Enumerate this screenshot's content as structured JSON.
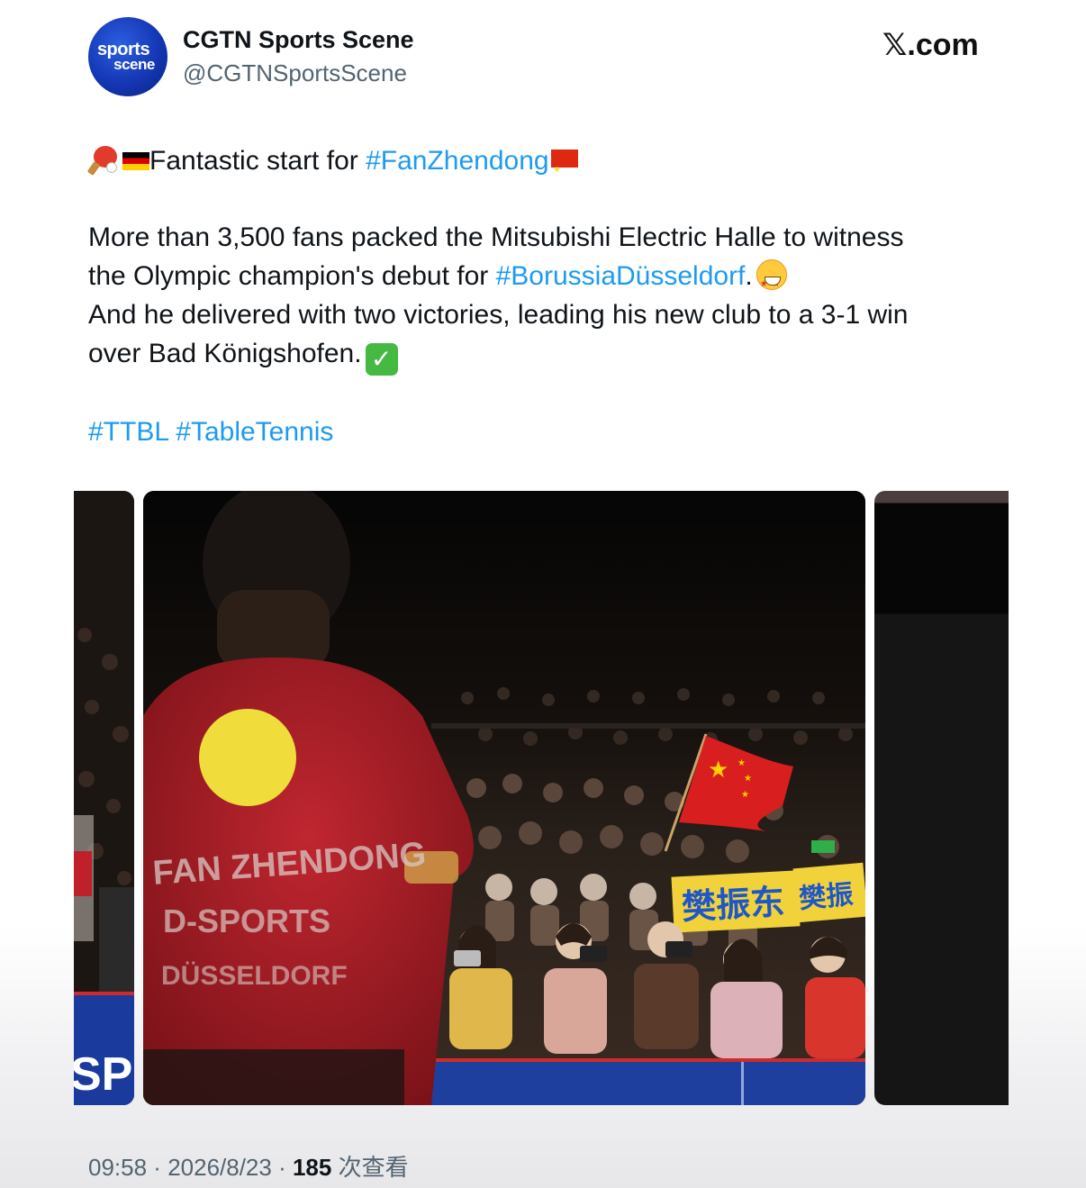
{
  "header": {
    "avatar_line1": "sports",
    "avatar_line2": "scene",
    "display_name": "CGTN Sports Scene",
    "handle": "@CGTNSportsScene",
    "site": "X.com"
  },
  "post": {
    "line1_text": "Fantastic start for ",
    "line1_hashtag": "#FanZhendong",
    "body_line1": "More than 3,500 fans packed the Mitsubishi Electric Halle to witness",
    "body_line2_text": "the Olympic champion's debut for ",
    "body_line2_hashtag": "#BorussiaDüsseldorf",
    "body_line2_end": ".",
    "body_line3": "And he delivered with two victories, leading his new club to a 3-1 win",
    "body_line4": "over Bad Königshofen.",
    "hashtag1": "#TTBL",
    "hashtag2": "#TableTennis"
  },
  "media": {
    "jersey_line1": "FAN ZHENDONG",
    "jersey_line2": "D-SPORTS",
    "jersey_line3": "DÜSSELDORF",
    "banner_text": "樊振东",
    "banner_text2": "樊振",
    "left_edge_text": "SP",
    "colors": {
      "jersey": "#b0202a",
      "banner": "#f2d23b",
      "banner_text": "#1e57c8",
      "board": "#1f3f9e"
    }
  },
  "footer": {
    "time": "09:58",
    "separator": " · ",
    "date": "2026/8/23",
    "views_count": "185",
    "views_label": " 次查看"
  }
}
